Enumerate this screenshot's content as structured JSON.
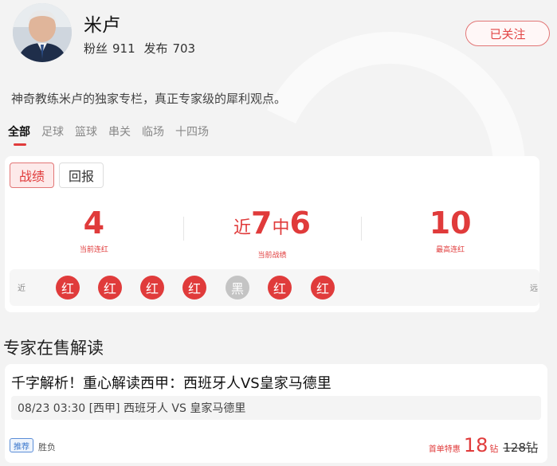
{
  "profile": {
    "name": "米卢",
    "fans_label": "粉丝",
    "fans_count": "911",
    "posts_label": "发布",
    "posts_count": "703",
    "follow_label": "已关注",
    "description": "神奇教练米卢的独家专栏，真正专家级的犀利观点。"
  },
  "tabs": [
    {
      "label": "全部",
      "active": true
    },
    {
      "label": "足球"
    },
    {
      "label": "篮球"
    },
    {
      "label": "串关"
    },
    {
      "label": "临场"
    },
    {
      "label": "十四场"
    }
  ],
  "record": {
    "segments": [
      "战绩",
      "回报"
    ],
    "current_streak": "4",
    "current_streak_label": "当前连红",
    "recent_prefix": "近",
    "recent_total": "7",
    "recent_mid": "中",
    "recent_hits": "6",
    "recent_label": "当前战绩",
    "best_streak": "10",
    "best_streak_label": "最高连红",
    "near_label": "近",
    "far_label": "远",
    "results": [
      "红",
      "红",
      "红",
      "红",
      "黑",
      "红",
      "红"
    ]
  },
  "section_title": "专家在售解读",
  "article": {
    "title": "千字解析！重心解读西甲：西班牙人VS皇家马德里",
    "match": "08/23 03:30 [西甲] 西班牙人 VS 皇家马德里",
    "tag": "推荐",
    "play_type": "胜负",
    "price_label": "首单特惠",
    "price": "18",
    "price_unit": "钻",
    "old_price": "128钻"
  },
  "colors": {
    "accent": "#e03b3b",
    "loss": "#c4c4c4",
    "tag_blue": "#3c78cc"
  }
}
